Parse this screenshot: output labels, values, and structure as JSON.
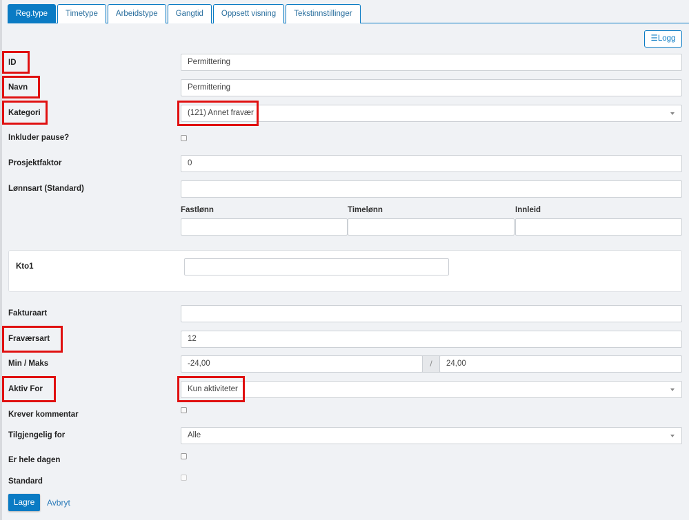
{
  "tabs": [
    "Reg.type",
    "Timetype",
    "Arbeidstype",
    "Gangtid",
    "Oppsett visning",
    "Tekstinnstillinger"
  ],
  "logg_label": "Logg",
  "labels": {
    "id": "ID",
    "navn": "Navn",
    "kategori": "Kategori",
    "inkluder_pause": "Inkluder pause?",
    "prosjektfaktor": "Prosjektfaktor",
    "lonnsart": "Lønnsart (Standard)",
    "kto1": "Kto1",
    "fakturaart": "Fakturaart",
    "fravaersart": "Fraværsart",
    "min_maks": "Min / Maks",
    "aktiv_for": "Aktiv For",
    "krever_kommentar": "Krever kommentar",
    "tilgjengelig_for": "Tilgjengelig for",
    "er_hele_dagen": "Er hele dagen",
    "standard": "Standard"
  },
  "columns": [
    "Fastlønn",
    "Timelønn",
    "Innleid"
  ],
  "values": {
    "id": "Permittering",
    "navn": "Permittering",
    "kategori": "(121) Annet fravær",
    "prosjektfaktor": "0",
    "fravaersart": "12",
    "min": "-24,00",
    "separator": "/",
    "maks": "24,00",
    "aktiv_for": "Kun aktiviteter",
    "tilgjengelig_for": "Alle"
  },
  "buttons": {
    "save": "Lagre",
    "cancel": "Avbryt"
  }
}
